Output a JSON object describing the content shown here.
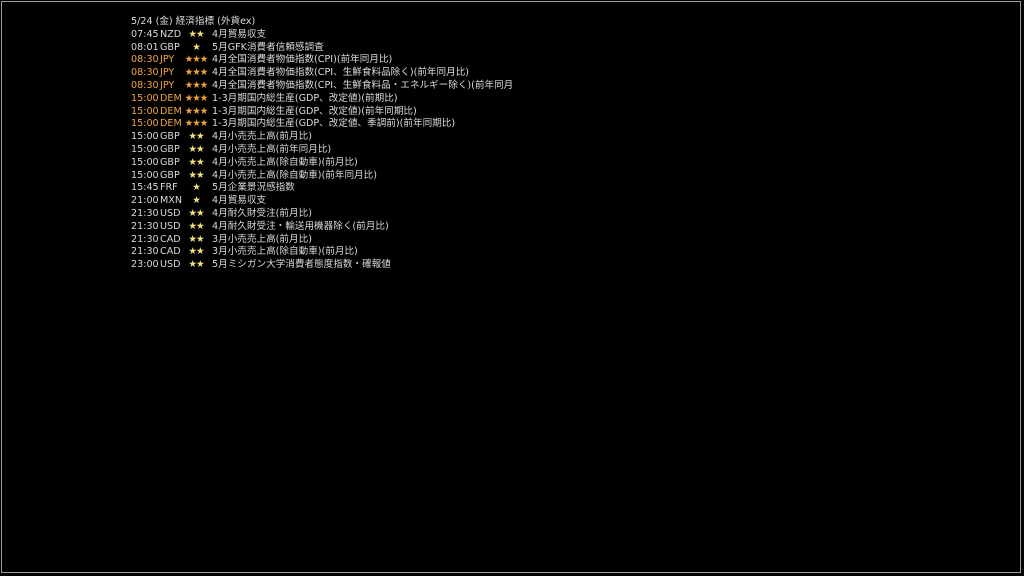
{
  "header": {
    "title": "5/24 (金) 経済指標 (外貨ex)"
  },
  "events": [
    {
      "time": "07:45",
      "currency": "NZD",
      "stars": "★★",
      "desc": "4月貿易収支",
      "highlight": false
    },
    {
      "time": "08:01",
      "currency": "GBP",
      "stars": "★",
      "desc": "5月GFK消費者信頼感調査",
      "highlight": false
    },
    {
      "time": "08:30",
      "currency": "JPY",
      "stars": "★★★",
      "desc": "4月全国消費者物価指数(CPI)(前年同月比)",
      "highlight": true
    },
    {
      "time": "08:30",
      "currency": "JPY",
      "stars": "★★★",
      "desc": "4月全国消費者物価指数(CPI、生鮮食料品除く)(前年同月比)",
      "highlight": true
    },
    {
      "time": "08:30",
      "currency": "JPY",
      "stars": "★★★",
      "desc": "4月全国消費者物価指数(CPI、生鮮食料品・エネルギー除く)(前年同月",
      "highlight": true
    },
    {
      "time": "15:00",
      "currency": "DEM",
      "stars": "★★★",
      "desc": "1-3月期国内総生産(GDP、改定値)(前期比)",
      "highlight": true
    },
    {
      "time": "15:00",
      "currency": "DEM",
      "stars": "★★★",
      "desc": "1-3月期国内総生産(GDP、改定値)(前年同期比)",
      "highlight": true
    },
    {
      "time": "15:00",
      "currency": "DEM",
      "stars": "★★★",
      "desc": "1-3月期国内総生産(GDP、改定値、季調前)(前年同期比)",
      "highlight": true
    },
    {
      "time": "15:00",
      "currency": "GBP",
      "stars": "★★",
      "desc": "4月小売売上高(前月比)",
      "highlight": false
    },
    {
      "time": "15:00",
      "currency": "GBP",
      "stars": "★★",
      "desc": "4月小売売上高(前年同月比)",
      "highlight": false
    },
    {
      "time": "15:00",
      "currency": "GBP",
      "stars": "★★",
      "desc": "4月小売売上高(除自動車)(前月比)",
      "highlight": false
    },
    {
      "time": "15:00",
      "currency": "GBP",
      "stars": "★★",
      "desc": "4月小売売上高(除自動車)(前年同月比)",
      "highlight": false
    },
    {
      "time": "15:45",
      "currency": "FRF",
      "stars": "★",
      "desc": "5月企業景況感指数",
      "highlight": false
    },
    {
      "time": "21:00",
      "currency": "MXN",
      "stars": "★",
      "desc": "4月貿易収支",
      "highlight": false
    },
    {
      "time": "21:30",
      "currency": "USD",
      "stars": "★★",
      "desc": "4月耐久財受注(前月比)",
      "highlight": false
    },
    {
      "time": "21:30",
      "currency": "USD",
      "stars": "★★",
      "desc": "4月耐久財受注・輸送用機器除く(前月比)",
      "highlight": false
    },
    {
      "time": "21:30",
      "currency": "CAD",
      "stars": "★★",
      "desc": "3月小売売上高(前月比)",
      "highlight": false
    },
    {
      "time": "21:30",
      "currency": "CAD",
      "stars": "★★",
      "desc": "3月小売売上高(除自動車)(前月比)",
      "highlight": false
    },
    {
      "time": "23:00",
      "currency": "USD",
      "stars": "★★",
      "desc": "5月ミシガン大学消費者態度指数・確報値",
      "highlight": false
    }
  ],
  "colors": {
    "background": "#000000",
    "text": "#d8d8d8",
    "highlight": "#f0a43b",
    "star": "#f7e27a",
    "border": "#9a9a9a"
  }
}
